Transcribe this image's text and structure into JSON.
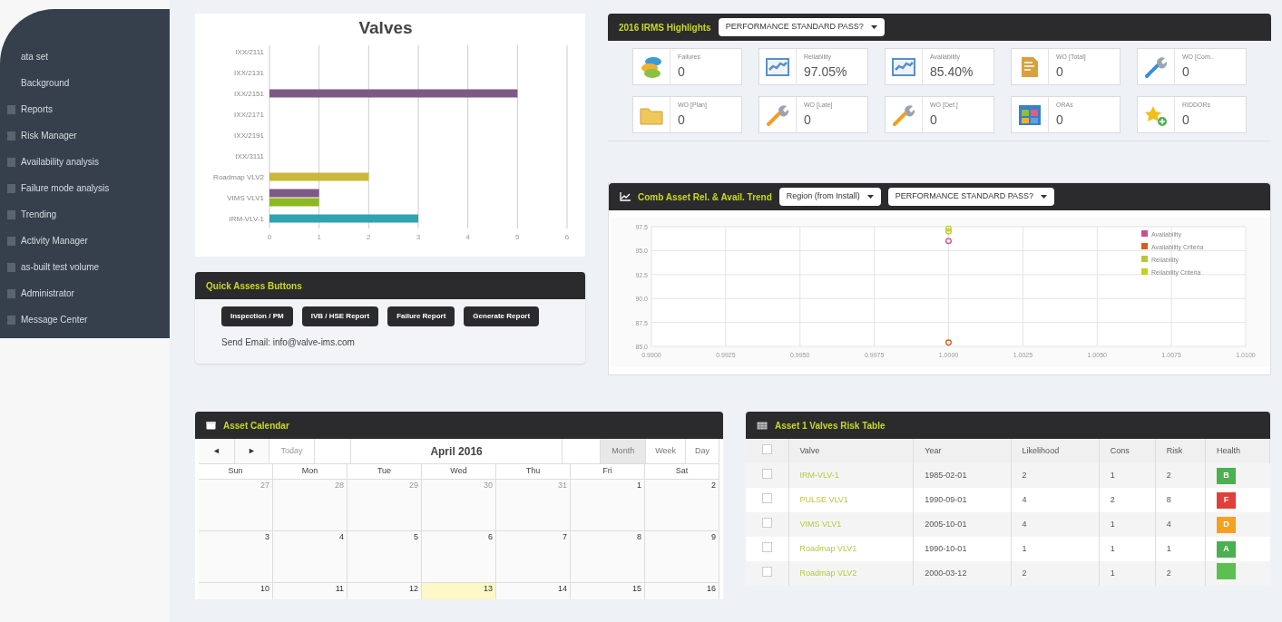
{
  "sidebar": {
    "items": [
      {
        "label": "ata set",
        "icon": false
      },
      {
        "label": "Background",
        "icon": false
      },
      {
        "label": "Reports",
        "icon": true
      },
      {
        "label": "Risk Manager",
        "icon": true
      },
      {
        "label": "Availability analysis",
        "icon": true
      },
      {
        "label": "Failure mode analysis",
        "icon": true
      },
      {
        "label": "Trending",
        "icon": true
      },
      {
        "label": "Activity Manager",
        "icon": true
      },
      {
        "label": "as-built test volume",
        "icon": true
      },
      {
        "label": "Administrator",
        "icon": true
      },
      {
        "label": "Message Center",
        "icon": true
      }
    ]
  },
  "valves_chart": {
    "chart_data": {
      "type": "bar",
      "title": "Valves",
      "orientation": "horizontal",
      "grid": true,
      "categories": [
        "IXX/2111",
        "IXX/2131",
        "IXX/2151",
        "IXX/2171",
        "IXX/2191",
        "IXX/3111",
        "Roadmap VLV2",
        "VIMS VLV1",
        "IRM-VLV-1"
      ],
      "xlim": [
        0,
        6
      ],
      "xticks": [
        0,
        1,
        2,
        3,
        4,
        5,
        6
      ],
      "series": [
        {
          "color": "#7d5a85",
          "values": [
            null,
            null,
            5,
            null,
            null,
            null,
            null,
            1,
            null
          ]
        },
        {
          "color": "#c9b83a",
          "values": [
            null,
            null,
            null,
            null,
            null,
            null,
            2,
            null,
            null
          ]
        },
        {
          "color": "#8db821",
          "values": [
            null,
            null,
            null,
            null,
            null,
            null,
            null,
            1,
            null
          ]
        },
        {
          "color": "#2fa3b0",
          "values": [
            null,
            null,
            null,
            null,
            null,
            null,
            null,
            null,
            3
          ]
        }
      ]
    }
  },
  "quick_assess": {
    "title": "Quick Assess Buttons",
    "buttons": [
      "Inspection / PM",
      "IVB / HSE Report",
      "Failure Report",
      "Generate Report"
    ],
    "email": "Send Email: info@valve-ims.com"
  },
  "highlights": {
    "title": "2016 IRMS Highlights",
    "filter": "PERFORMANCE STANDARD PASS?",
    "tiles": [
      {
        "kind": "stack",
        "color": "#3a9bd5",
        "label": "Failures",
        "value": "0"
      },
      {
        "kind": "chart",
        "color": "#5a8fc8",
        "label": "Reliability",
        "value": "97.05%"
      },
      {
        "kind": "chart",
        "color": "#5a8fc8",
        "label": "Availability",
        "value": "85.40%"
      },
      {
        "kind": "document",
        "color": "#d9a040",
        "label": "WO [Total]",
        "value": "0"
      },
      {
        "kind": "wrench",
        "color": "#3a8fd8",
        "label": "WO [Com..",
        "value": "0"
      },
      {
        "kind": "folder",
        "color": "#f0c85a",
        "label": "WO [Plan]",
        "value": "0"
      },
      {
        "kind": "wrench",
        "color": "#f0a020",
        "label": "WO [Late]",
        "value": "0"
      },
      {
        "kind": "wrench",
        "color": "#f0a020",
        "label": "WO [Def.]",
        "value": "0"
      },
      {
        "kind": "panels",
        "color": "#3a7fc8",
        "label": "ORAs",
        "value": "0"
      },
      {
        "kind": "star",
        "color": "#f0c020",
        "label": "RIDDORs",
        "value": "0"
      }
    ]
  },
  "trend": {
    "title": "Comb Asset Rel. & Avail. Trend",
    "filters": [
      "Region (from Install)",
      "PERFORMANCE STANDARD PASS?"
    ],
    "chart_data": {
      "type": "scatter",
      "grid": true,
      "legend": "upper right",
      "x": [
        1.0
      ],
      "xlim": [
        0.99,
        1.01
      ],
      "ylim": [
        85,
        97.5
      ],
      "xticks": [
        {
          "value": 0.99,
          "label": "0.9900"
        },
        {
          "value": 0.9925,
          "label": "0.9925"
        },
        {
          "value": 0.995,
          "label": "0.9950"
        },
        {
          "value": 0.9975,
          "label": "0.9975"
        },
        {
          "value": 1.0,
          "label": "1.0000"
        },
        {
          "value": 1.0025,
          "label": "1.0025"
        },
        {
          "value": 1.005,
          "label": "1.0050"
        },
        {
          "value": 1.0075,
          "label": "1.0075"
        },
        {
          "value": 1.01,
          "label": "1.0100"
        }
      ],
      "yticks": [
        {
          "value": 85,
          "label": "85.0"
        },
        {
          "value": 87.5,
          "label": "87.5"
        },
        {
          "value": 90,
          "label": "90.0"
        },
        {
          "value": 92.5,
          "label": "92.5"
        },
        {
          "value": 95,
          "label": "95.0"
        },
        {
          "value": 97.5,
          "label": "97.5"
        }
      ],
      "series": [
        {
          "name": "Availability",
          "color": "#c8508a",
          "values": [
            96.0
          ]
        },
        {
          "name": "Availability Criteria",
          "color": "#d0601a",
          "values": [
            85.4
          ]
        },
        {
          "name": "Reliability",
          "color": "#b8c830",
          "values": [
            97.0
          ]
        },
        {
          "name": "Reliability Criteria",
          "color": "#c8d010",
          "values": [
            97.3
          ]
        }
      ]
    }
  },
  "calendar": {
    "title": "Asset Calendar",
    "prev": "◄",
    "next": "►",
    "today": "Today",
    "month_title": "April 2016",
    "views": [
      {
        "label": "Month",
        "selected": true
      },
      {
        "label": "Week",
        "selected": false
      },
      {
        "label": "Day",
        "selected": false
      }
    ],
    "weekdays": [
      "Sun",
      "Mon",
      "Tue",
      "Wed",
      "Thu",
      "Fri",
      "Sat"
    ],
    "weeks": [
      [
        {
          "day": "27",
          "other": true,
          "today": false
        },
        {
          "day": "28",
          "other": true,
          "today": false
        },
        {
          "day": "29",
          "other": true,
          "today": false
        },
        {
          "day": "30",
          "other": true,
          "today": false
        },
        {
          "day": "31",
          "other": true,
          "today": false
        },
        {
          "day": "1",
          "other": false,
          "today": false
        },
        {
          "day": "2",
          "other": false,
          "today": false
        }
      ],
      [
        {
          "day": "3",
          "other": false,
          "today": false
        },
        {
          "day": "4",
          "other": false,
          "today": false
        },
        {
          "day": "5",
          "other": false,
          "today": false
        },
        {
          "day": "6",
          "other": false,
          "today": false
        },
        {
          "day": "7",
          "other": false,
          "today": false
        },
        {
          "day": "8",
          "other": false,
          "today": false
        },
        {
          "day": "9",
          "other": false,
          "today": false
        }
      ],
      [
        {
          "day": "10",
          "other": false,
          "today": false
        },
        {
          "day": "11",
          "other": false,
          "today": false
        },
        {
          "day": "12",
          "other": false,
          "today": false
        },
        {
          "day": "13",
          "other": false,
          "today": true
        },
        {
          "day": "14",
          "other": false,
          "today": false
        },
        {
          "day": "15",
          "other": false,
          "today": false
        },
        {
          "day": "16",
          "other": false,
          "today": false
        }
      ]
    ]
  },
  "risk_table": {
    "title": "Asset 1 Valves Risk Table",
    "select_all_checked": false,
    "columns": [
      "Valve",
      "Year",
      "Likelihood",
      "Cons",
      "Risk",
      "Health"
    ],
    "rows": [
      {
        "checked": false,
        "valve": "IRM-VLV-1",
        "year": "1985-02-01",
        "likelihood": "2",
        "cons": "1",
        "risk": "2",
        "health": "B",
        "color": "#4caf50"
      },
      {
        "checked": false,
        "valve": "PULSE VLV1",
        "year": "1990-09-01",
        "likelihood": "4",
        "cons": "2",
        "risk": "8",
        "health": "F",
        "color": "#e0403a"
      },
      {
        "checked": false,
        "valve": "VIMS VLV1",
        "year": "2005-10-01",
        "likelihood": "4",
        "cons": "1",
        "risk": "4",
        "health": "D",
        "color": "#f5a020"
      },
      {
        "checked": false,
        "valve": "Roadmap VLV1",
        "year": "1990-10-01",
        "likelihood": "1",
        "cons": "1",
        "risk": "1",
        "health": "A",
        "color": "#4caf50"
      },
      {
        "checked": false,
        "valve": "Roadmap VLV2",
        "year": "2000-03-12",
        "likelihood": "2",
        "cons": "1",
        "risk": "2",
        "color": "#5cc050"
      }
    ]
  }
}
